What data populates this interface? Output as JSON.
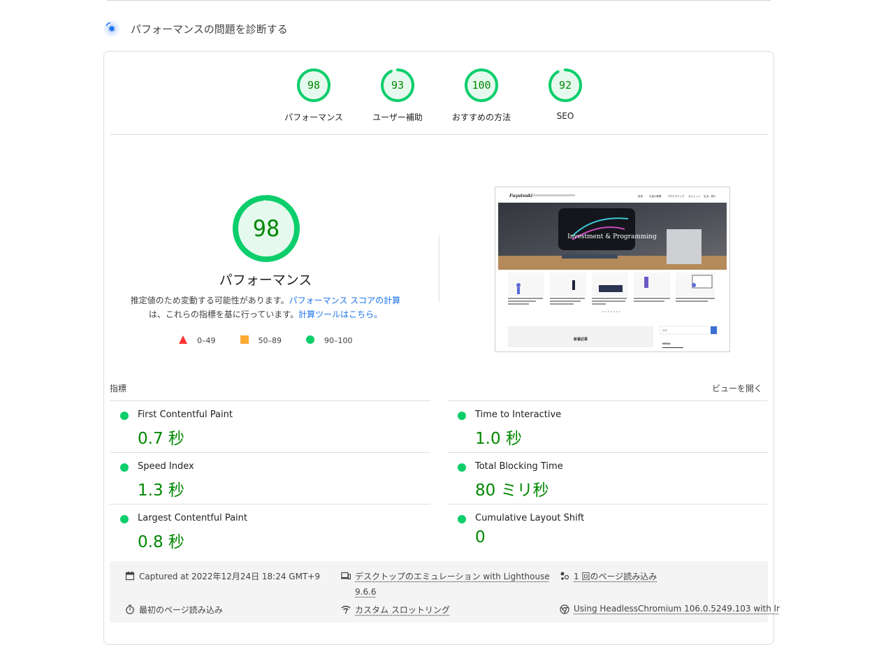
{
  "section": {
    "title": "パフォーマンスの問題を診断する"
  },
  "gauges": [
    {
      "score": "98",
      "label": "パフォーマンス",
      "fraction": 0.98
    },
    {
      "score": "93",
      "label": "ユーザー補助",
      "fraction": 0.93
    },
    {
      "score": "100",
      "label": "おすすめの方法",
      "fraction": 1.0
    },
    {
      "score": "92",
      "label": "SEO",
      "fraction": 0.92
    }
  ],
  "performance": {
    "score": "98",
    "fraction": 0.98,
    "title": "パフォーマンス",
    "desc_1": "推定値のため変動する可能性があります。",
    "link_1": "パフォーマンス スコアの計算",
    "desc_2": "は、これらの指標を基に行っています。",
    "link_2": "計算ツールはこちら。"
  },
  "legend": [
    {
      "range": "0–49",
      "color": "#ff3333",
      "shape": "triangle"
    },
    {
      "range": "50–89",
      "color": "#ffaa33",
      "shape": "square"
    },
    {
      "range": "90–100",
      "color": "#0cce6b",
      "shape": "circle"
    }
  ],
  "screenshot": {
    "site_name": "Fuyutsuki",
    "nav": [
      "投資",
      "お金の教養",
      "プログラミング",
      "ガジェット",
      "生活・旅行"
    ],
    "hero_text": "Investment & Programming",
    "recent_label": "新着記事",
    "search_placeholder": "検索",
    "menu_label": "MENU"
  },
  "metrics_header": {
    "left": "指標",
    "right": "ビューを開く"
  },
  "metrics": [
    {
      "name": "First Contentful Paint",
      "value": "0.7 秒"
    },
    {
      "name": "Time to Interactive",
      "value": "1.0 秒"
    },
    {
      "name": "Speed Index",
      "value": "1.3 秒"
    },
    {
      "name": "Total Blocking Time",
      "value": "80 ミリ秒"
    },
    {
      "name": "Largest Contentful Paint",
      "value": "0.8 秒"
    },
    {
      "name": "Cumulative Layout Shift",
      "value": "0"
    }
  ],
  "info": {
    "captured": "Captured at 2022年12月24日 18:24 GMT+9",
    "emulation": "デスクトップのエミュレーション with Lighthouse",
    "emulation_version": "9.6.6",
    "page_loads": "1 回のページ読み込み",
    "initial_load": "最初のページ読み込み",
    "throttling": "カスタム スロットリング",
    "browser": "Using HeadlessChromium 106.0.5249.103 with lr"
  },
  "colors": {
    "pass": "#0cce6b",
    "pass_text": "#008800",
    "pass_bg": "#e6f9ee",
    "link": "#1a73e8"
  }
}
